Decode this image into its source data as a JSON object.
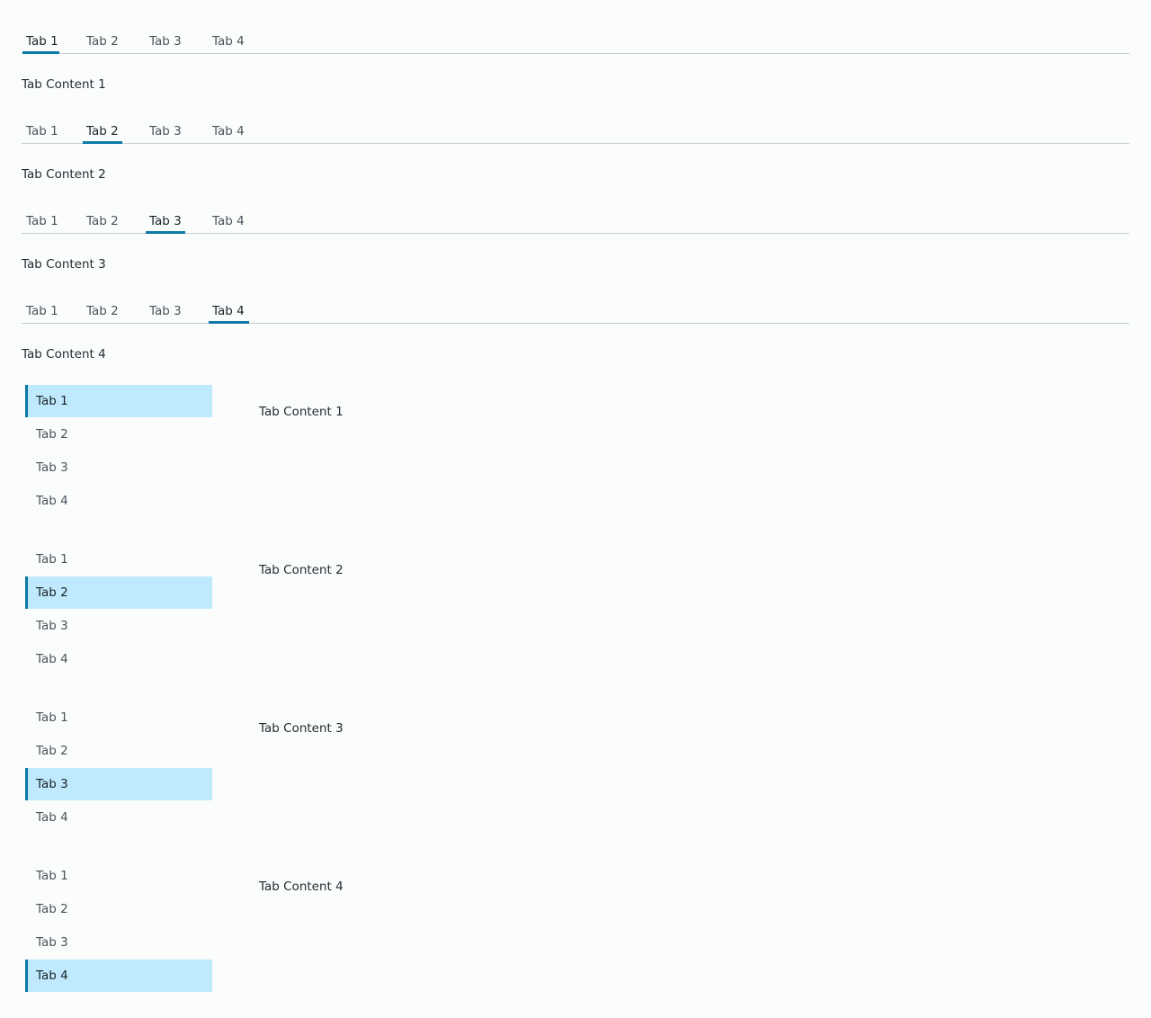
{
  "horizontal_groups": [
    {
      "tabs": [
        "Tab 1",
        "Tab 2",
        "Tab 3",
        "Tab 4"
      ],
      "active": "Tab 1",
      "content": "Tab Content 1"
    },
    {
      "tabs": [
        "Tab 1",
        "Tab 2",
        "Tab 3",
        "Tab 4"
      ],
      "active": "Tab 2",
      "content": "Tab Content 2"
    },
    {
      "tabs": [
        "Tab 1",
        "Tab 2",
        "Tab 3",
        "Tab 4"
      ],
      "active": "Tab 3",
      "content": "Tab Content 3"
    },
    {
      "tabs": [
        "Tab 1",
        "Tab 2",
        "Tab 3",
        "Tab 4"
      ],
      "active": "Tab 4",
      "content": "Tab Content 4"
    }
  ],
  "vertical_groups": [
    {
      "tabs": [
        "Tab 1",
        "Tab 2",
        "Tab 3",
        "Tab 4"
      ],
      "active": "Tab 1",
      "content": "Tab Content 1"
    },
    {
      "tabs": [
        "Tab 1",
        "Tab 2",
        "Tab 3",
        "Tab 4"
      ],
      "active": "Tab 2",
      "content": "Tab Content 2"
    },
    {
      "tabs": [
        "Tab 1",
        "Tab 2",
        "Tab 3",
        "Tab 4"
      ],
      "active": "Tab 3",
      "content": "Tab Content 3"
    },
    {
      "tabs": [
        "Tab 1",
        "Tab 2",
        "Tab 3",
        "Tab 4"
      ],
      "active": "Tab 4",
      "content": "Tab Content 4"
    }
  ],
  "colors": {
    "accent": "#0c79a6",
    "active_vertical_bg": "#bfeafd",
    "divider": "#c9cfd2",
    "page_bg": "#fbfdfd"
  }
}
